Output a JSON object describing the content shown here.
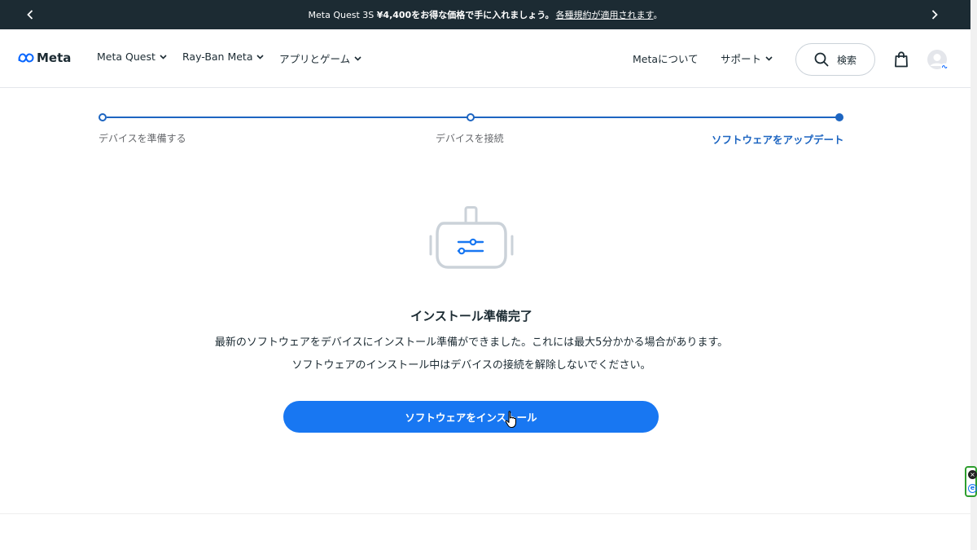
{
  "promo": {
    "text_prefix": "Meta Quest 3S ",
    "text_bold": "¥4,400をお得な価格で手に入れましょう。",
    "link": "各種規約が適用されます",
    "suffix": "。"
  },
  "nav": {
    "logo": "Meta",
    "items": [
      "Meta Quest",
      "Ray-Ban Meta",
      "アプリとゲーム"
    ],
    "about": "Metaについて",
    "support": "サポート",
    "search": "検索"
  },
  "stepper": {
    "steps": [
      "デバイスを準備する",
      "デバイスを接続",
      "ソフトウェアをアップデート"
    ],
    "active_index": 2
  },
  "main": {
    "title": "インストール準備完了",
    "desc1": "最新のソフトウェアをデバイスにインストール準備ができました。これには最大5分かかる場合があります。",
    "desc2": "ソフトウェアのインストール中はデバイスの接続を解除しないでください。",
    "button": "ソフトウェアをインストール"
  },
  "colors": {
    "accent": "#1877f2",
    "step": "#1d65c1",
    "banner": "#1c2b33"
  },
  "icons": [
    "chevron-left-icon",
    "chevron-right-icon",
    "meta-logo-icon",
    "chevron-down-icon",
    "search-icon",
    "shopping-bag-icon",
    "avatar-icon",
    "headset-icon",
    "pointer-cursor-icon"
  ]
}
